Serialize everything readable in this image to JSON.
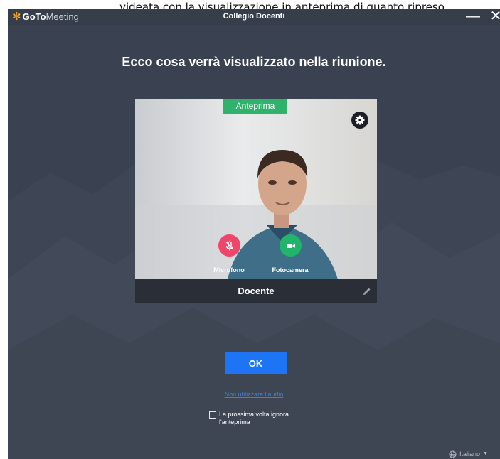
{
  "caption": "videata con la visualizzazione in anteprima di quanto ripreso",
  "app": {
    "brand_go": "GoTo",
    "brand_meeting": "Meeting",
    "window_title": "Collegio Docenti",
    "minimize_symbol": "—",
    "close_symbol": "✕"
  },
  "dialog": {
    "headline": "Ecco cosa verrà visualizzato nella riunione.",
    "preview_badge": "Anteprima",
    "mic_label": "Microfono",
    "camera_label": "Fotocamera",
    "participant_name": "Docente",
    "ok_label": "OK",
    "no_audio_link": "Non utilizzare l'audio",
    "skip_preview_label": "La prossima volta ignora l'anteprima"
  },
  "footer": {
    "language": "Italiano",
    "language_chevron": "▼"
  },
  "icons": {
    "brand": "gotomeeting-logo-icon",
    "settings": "gear-icon",
    "mic": "mic-off-icon",
    "camera": "video-camera-icon",
    "edit": "pencil-icon",
    "language": "globe-icon"
  },
  "colors": {
    "window_bg": "#3a4150",
    "ok_button": "#1d74f5",
    "badge": "#2fb36a",
    "mic_button": "#f0456a",
    "camera_button": "#21b46a",
    "link": "#3b7fe0",
    "brand_accent": "#f6a623"
  }
}
